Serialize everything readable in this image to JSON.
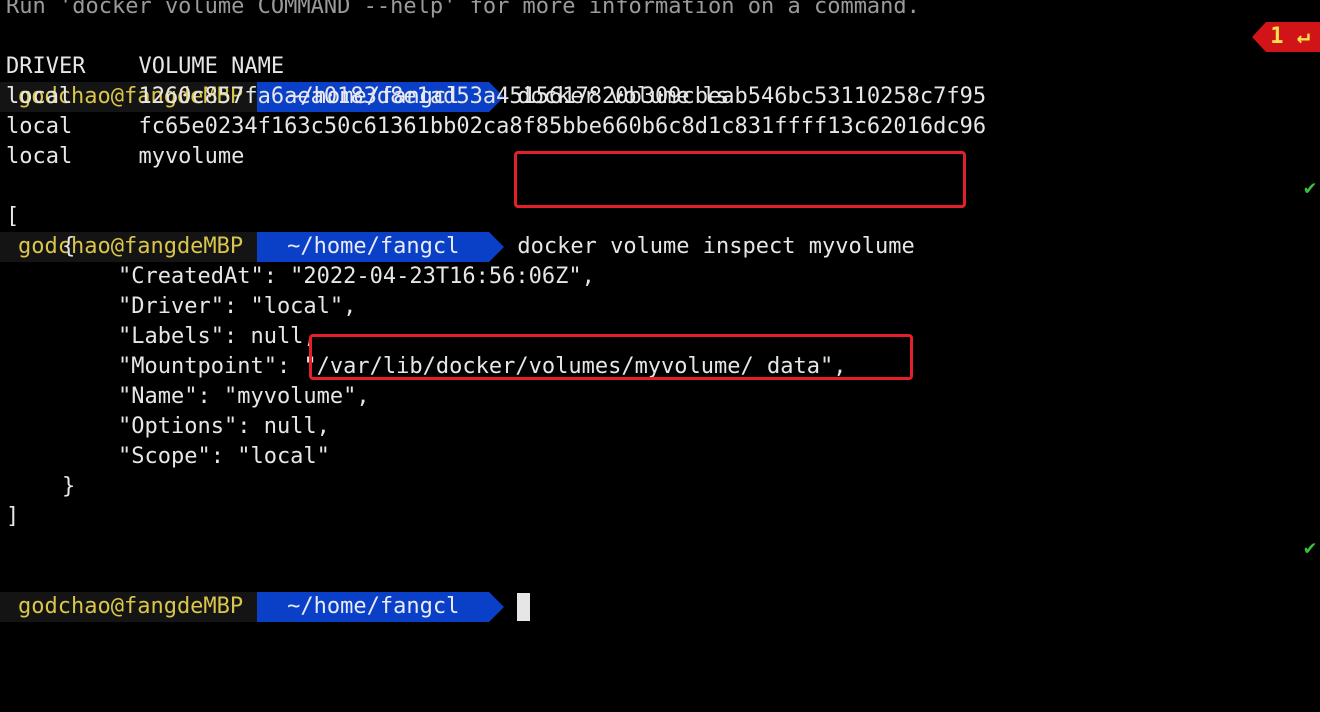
{
  "terminal": {
    "top_line": "Run 'docker volume COMMAND --help' for more information on a command.",
    "prompt1": {
      "user": "godchao@fangdeMBP",
      "dir": "~/home/fangcl",
      "command": "docker volume ls",
      "exit_code": "1",
      "exit_symbol": "↵"
    },
    "ls_output": {
      "header": "DRIVER    VOLUME NAME",
      "rows": [
        "local     1260c857fa6aea0183d8e1ad53a4515617820b309cbeab546bc53110258c7f95",
        "local     fc65e0234f163c50c61361bb02ca8f85bbe660b6c8d1c831ffff13c62016dc96",
        "local     myvolume"
      ]
    },
    "prompt2": {
      "user": "godchao@fangdeMBP",
      "dir": "~/home/fangcl",
      "command": "docker volume inspect myvolume",
      "status": "✔"
    },
    "inspect_output": {
      "open_bracket": "[",
      "open_brace": "{",
      "created_at": "\"CreatedAt\": \"2022-04-23T16:56:06Z\",",
      "driver": "\"Driver\": \"local\",",
      "labels": "\"Labels\": null,",
      "mountpoint_key": "\"Mountpoint\": ",
      "mountpoint_value": "\"/var/lib/docker/volumes/myvolume/_data\",",
      "name": "\"Name\": \"myvolume\",",
      "options": "\"Options\": null,",
      "scope": "\"Scope\": \"local\"",
      "close_brace": "}",
      "close_bracket": "]"
    },
    "prompt3": {
      "user": "godchao@fangdeMBP",
      "dir": "~/home/fangcl",
      "status": "✔"
    }
  },
  "colors": {
    "background": "#000000",
    "user_segment": "#141414",
    "user_text": "#d9c64a",
    "dir_segment": "#0a3fc8",
    "error_badge": "#d11418",
    "highlight": "#e3202a",
    "success": "#3bbf3b"
  }
}
